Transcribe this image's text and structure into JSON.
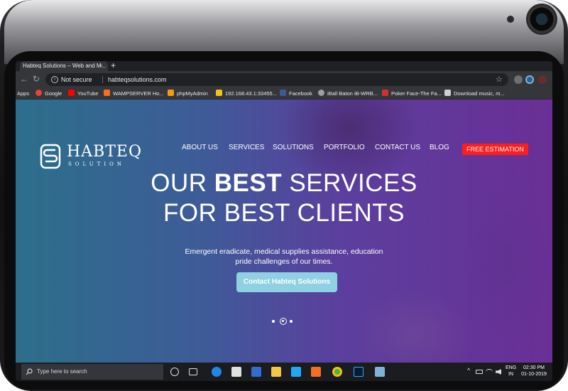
{
  "browser": {
    "tab_title": "Habteq Solutions – Web and M...",
    "close_glyph": "×",
    "new_tab_glyph": "+",
    "security_label": "Not secure",
    "url": "habteqsolutions.com",
    "star_glyph": "☆",
    "back_glyph": "←",
    "reload_glyph": "↻",
    "bookmarks": [
      {
        "label": "Apps",
        "icon": "apps-grid-icon",
        "color": ""
      },
      {
        "label": "Google",
        "icon": "google-icon",
        "color": "#ea4335"
      },
      {
        "label": "YouTube",
        "icon": "youtube-icon",
        "color": "#ff0000"
      },
      {
        "label": "WAMPSERVER Ho...",
        "icon": "wampserver-icon",
        "color": "#f37021"
      },
      {
        "label": "phpMyAdmin",
        "icon": "phpmyadmin-icon",
        "color": "#f89c0e"
      },
      {
        "label": "192.168.43.1:33455...",
        "icon": "server-icon",
        "color": "#f0c419"
      },
      {
        "label": "Facebook",
        "icon": "facebook-icon",
        "color": "#3b5998"
      },
      {
        "label": "iBall Baton iB-WRB...",
        "icon": "iball-icon",
        "color": "#9e9e9e"
      },
      {
        "label": "Poker Face-The Fa...",
        "icon": "poker-icon",
        "color": "#d32f2f"
      },
      {
        "label": "Download music, m...",
        "icon": "download-icon",
        "color": "#cfcfcf"
      }
    ]
  },
  "site": {
    "logo_text": "HABTEQ",
    "logo_sub": "SOLUTION",
    "menu": [
      "ABOUT US",
      "SERVICES",
      "SOLUTIONS",
      "PORTFOLIO",
      "CONTACT US",
      "BLOG"
    ],
    "cta_nav": "FREE ESTIMATION",
    "hero_line1_pre": "OUR ",
    "hero_line1_bold": "BEST",
    "hero_line1_post": " SERVICES",
    "hero_line2": "FOR BEST CLIENTS",
    "hero_text_1": "Emergent eradicate, medical supplies assistance, education",
    "hero_text_2": "pride challenges of our times.",
    "hero_button": "Contact Habteq Solutions",
    "slider_active_index": 1,
    "slider_count": 3
  },
  "taskbar": {
    "search_placeholder": "Type here to search",
    "lang_1": "ENG",
    "lang_2": "IN",
    "time": "02:30 PM",
    "date": "01-10-2019"
  },
  "colors": {
    "cta_red": "#ff1c1c",
    "button_blue": "#8fd0e3",
    "hero_left": "#2c6f8b",
    "hero_right": "#6a2f96"
  }
}
